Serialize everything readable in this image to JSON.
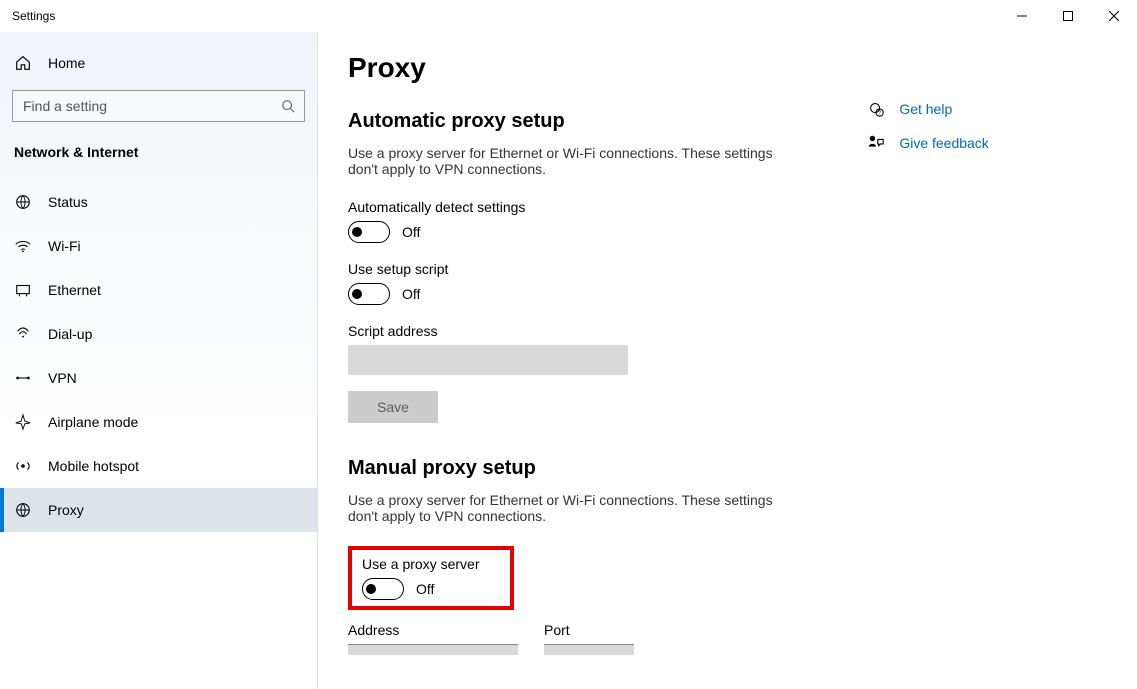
{
  "window": {
    "title": "Settings"
  },
  "sidebar": {
    "home": "Home",
    "search_placeholder": "Find a setting",
    "category": "Network & Internet",
    "items": [
      {
        "label": "Status"
      },
      {
        "label": "Wi-Fi"
      },
      {
        "label": "Ethernet"
      },
      {
        "label": "Dial-up"
      },
      {
        "label": "VPN"
      },
      {
        "label": "Airplane mode"
      },
      {
        "label": "Mobile hotspot"
      },
      {
        "label": "Proxy",
        "active": true
      }
    ]
  },
  "page": {
    "title": "Proxy",
    "auto": {
      "header": "Automatic proxy setup",
      "desc": "Use a proxy server for Ethernet or Wi-Fi connections. These settings don't apply to VPN connections.",
      "auto_detect_label": "Automatically detect settings",
      "auto_detect_state": "Off",
      "setup_script_label": "Use setup script",
      "setup_script_state": "Off",
      "script_address_label": "Script address",
      "script_address_value": "",
      "save": "Save"
    },
    "manual": {
      "header": "Manual proxy setup",
      "desc": "Use a proxy server for Ethernet or Wi-Fi connections. These settings don't apply to VPN connections.",
      "use_proxy_label": "Use a proxy server",
      "use_proxy_state": "Off",
      "address_label": "Address",
      "port_label": "Port"
    }
  },
  "aside": {
    "help": "Get help",
    "feedback": "Give feedback"
  }
}
